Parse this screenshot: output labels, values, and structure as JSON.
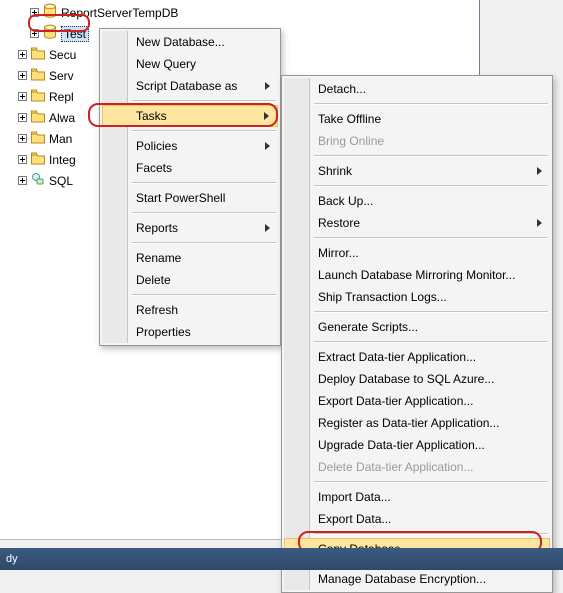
{
  "tree": {
    "items": [
      {
        "label": "ReportServerTempDB",
        "kind": "db",
        "expand": "plus",
        "depth": 2
      },
      {
        "label": "Test",
        "kind": "db",
        "expand": "plus",
        "depth": 2,
        "selected": true
      },
      {
        "label": "Secu",
        "kind": "folder",
        "expand": "plus",
        "depth": 1
      },
      {
        "label": "Serv",
        "kind": "folder",
        "expand": "plus",
        "depth": 1
      },
      {
        "label": "Repl",
        "kind": "folder",
        "expand": "plus",
        "depth": 1
      },
      {
        "label": "Alwa",
        "kind": "folder",
        "expand": "plus",
        "depth": 1
      },
      {
        "label": "Man",
        "kind": "folder",
        "expand": "plus",
        "depth": 1
      },
      {
        "label": "Integ",
        "kind": "folder",
        "expand": "plus",
        "depth": 1
      },
      {
        "label": "SQL",
        "kind": "sql",
        "expand": "plus",
        "depth": 1
      }
    ]
  },
  "menu1": [
    {
      "label": "New Database...",
      "type": "item"
    },
    {
      "label": "New Query",
      "type": "item"
    },
    {
      "label": "Script Database as",
      "type": "sub"
    },
    {
      "type": "sep"
    },
    {
      "label": "Tasks",
      "type": "sub",
      "hover": true
    },
    {
      "type": "sep"
    },
    {
      "label": "Policies",
      "type": "sub"
    },
    {
      "label": "Facets",
      "type": "item"
    },
    {
      "type": "sep"
    },
    {
      "label": "Start PowerShell",
      "type": "item"
    },
    {
      "type": "sep"
    },
    {
      "label": "Reports",
      "type": "sub"
    },
    {
      "type": "sep"
    },
    {
      "label": "Rename",
      "type": "item"
    },
    {
      "label": "Delete",
      "type": "item"
    },
    {
      "type": "sep"
    },
    {
      "label": "Refresh",
      "type": "item"
    },
    {
      "label": "Properties",
      "type": "item"
    }
  ],
  "menu2": [
    {
      "label": "Detach...",
      "type": "item"
    },
    {
      "type": "sep"
    },
    {
      "label": "Take Offline",
      "type": "item"
    },
    {
      "label": "Bring Online",
      "type": "item",
      "disabled": true
    },
    {
      "type": "sep"
    },
    {
      "label": "Shrink",
      "type": "sub"
    },
    {
      "type": "sep"
    },
    {
      "label": "Back Up...",
      "type": "item"
    },
    {
      "label": "Restore",
      "type": "sub"
    },
    {
      "type": "sep"
    },
    {
      "label": "Mirror...",
      "type": "item"
    },
    {
      "label": "Launch Database Mirroring Monitor...",
      "type": "item"
    },
    {
      "label": "Ship Transaction Logs...",
      "type": "item"
    },
    {
      "type": "sep"
    },
    {
      "label": "Generate Scripts...",
      "type": "item"
    },
    {
      "type": "sep"
    },
    {
      "label": "Extract Data-tier Application...",
      "type": "item"
    },
    {
      "label": "Deploy Database to SQL Azure...",
      "type": "item"
    },
    {
      "label": "Export Data-tier Application...",
      "type": "item"
    },
    {
      "label": "Register as Data-tier Application...",
      "type": "item"
    },
    {
      "label": "Upgrade Data-tier Application...",
      "type": "item"
    },
    {
      "label": "Delete Data-tier Application...",
      "type": "item",
      "disabled": true
    },
    {
      "type": "sep"
    },
    {
      "label": "Import Data...",
      "type": "item"
    },
    {
      "label": "Export Data...",
      "type": "item"
    },
    {
      "type": "sep"
    },
    {
      "label": "Copy Database...",
      "type": "item",
      "hover": true
    },
    {
      "type": "sep"
    },
    {
      "label": "Manage Database Encryption...",
      "type": "item"
    }
  ],
  "status": "dy"
}
